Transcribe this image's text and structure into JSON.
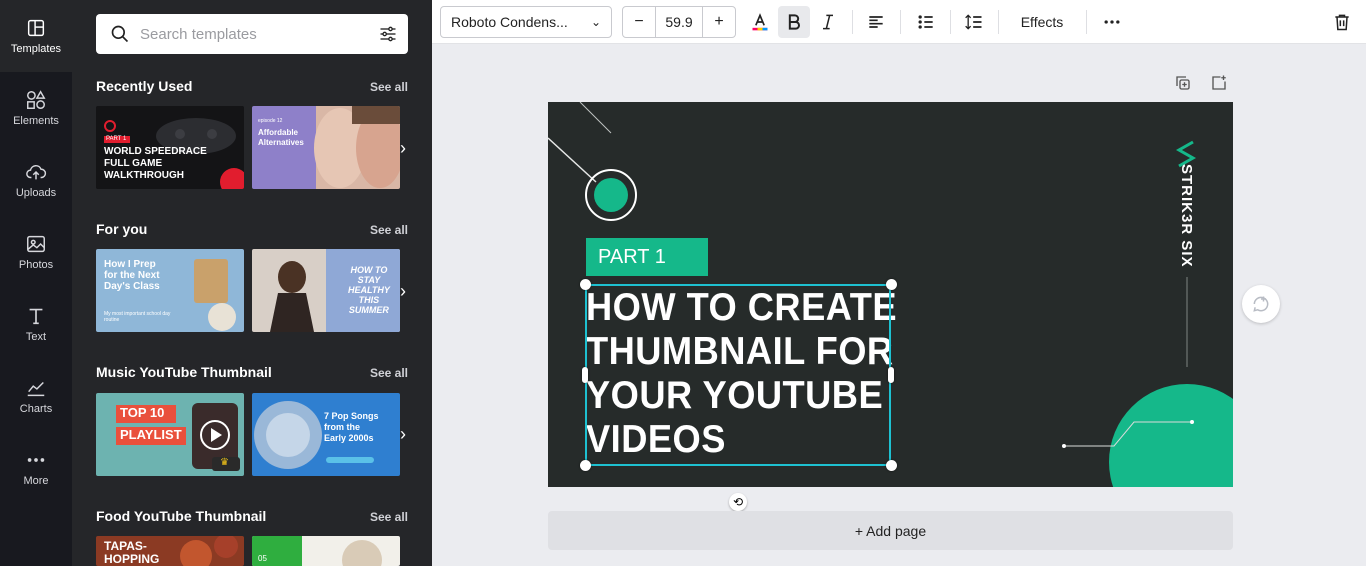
{
  "sidebar": {
    "items": [
      {
        "label": "Templates",
        "icon": "templates-icon"
      },
      {
        "label": "Elements",
        "icon": "elements-icon"
      },
      {
        "label": "Uploads",
        "icon": "cloud-upload-icon"
      },
      {
        "label": "Photos",
        "icon": "image-icon"
      },
      {
        "label": "Text",
        "icon": "text-icon"
      },
      {
        "label": "Charts",
        "icon": "chart-icon"
      },
      {
        "label": "More",
        "icon": "more-dots-icon"
      }
    ]
  },
  "panel": {
    "search_placeholder": "Search templates",
    "sections": [
      {
        "title": "Recently Used",
        "see_all": "See all",
        "thumbs": [
          {
            "lines": [
              "PART 1",
              "WORLD SPEEDRACE",
              "FULL GAME",
              "WALKTHROUGH"
            ]
          },
          {
            "lines": [
              "episode 12",
              "Affordable",
              "Alternatives"
            ]
          }
        ]
      },
      {
        "title": "For you",
        "see_all": "See all",
        "thumbs": [
          {
            "lines": [
              "How I Prep",
              "for the Next",
              "Day's Class",
              "My most important school day routine"
            ]
          },
          {
            "lines": [
              "HOW TO",
              "STAY",
              "HEALTHY",
              "THIS",
              "SUMMER"
            ]
          }
        ]
      },
      {
        "title": "Music YouTube Thumbnail",
        "see_all": "See all",
        "thumbs": [
          {
            "lines": [
              "TOP 10",
              "PLAYLIST"
            ]
          },
          {
            "lines": [
              "7 Pop Songs",
              "from the",
              "Early 2000s"
            ]
          }
        ]
      },
      {
        "title": "Food YouTube Thumbnail",
        "see_all": "See all",
        "thumbs": [
          {
            "lines": [
              "TAPAS-",
              "HOPPING"
            ]
          },
          {
            "lines": [
              "05"
            ]
          }
        ]
      }
    ]
  },
  "toolbar": {
    "font": "Roboto Condens...",
    "minus": "−",
    "size": "59.9",
    "plus": "+",
    "effects": "Effects"
  },
  "design": {
    "part_tag": "PART 1",
    "headline_lines": [
      "HOW TO CREATE",
      "THUMBNAIL FOR",
      "YOUR YOUTUBE",
      "VIDEOS"
    ],
    "brand": "STRIK3R SIX"
  },
  "add_page": "+ Add page",
  "colors": {
    "accent": "#15b88a",
    "artboard": "#262b2a",
    "selection": "#1ec1d1"
  }
}
